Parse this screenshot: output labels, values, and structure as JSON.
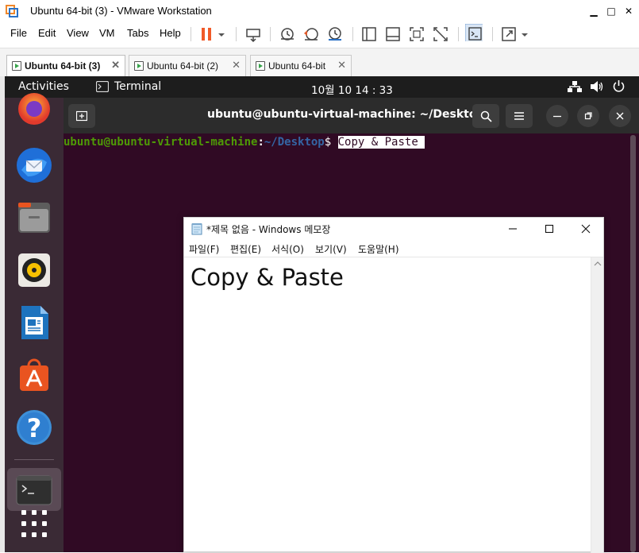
{
  "vmware": {
    "title": "Ubuntu 64-bit (3) - VMware Workstation",
    "menus": [
      "File",
      "Edit",
      "View",
      "VM",
      "Tabs",
      "Help"
    ],
    "tabs": [
      {
        "label": "Ubuntu 64-bit (3)",
        "active": true
      },
      {
        "label": "Ubuntu 64-bit (2)",
        "active": false
      },
      {
        "label": "Ubuntu 64-bit",
        "active": false
      }
    ],
    "colors": {
      "pause": "#f05a28",
      "snapshot": "#e05a2a"
    }
  },
  "ubuntu": {
    "topbar": {
      "activities": "Activities",
      "app": "Terminal",
      "clock": "10월 10  14 : 33"
    },
    "dock": [
      "firefox-icon",
      "thunderbird-icon",
      "files-icon",
      "rhythmbox-icon",
      "writer-icon",
      "software-icon",
      "help-icon",
      "terminal-icon",
      "app-grid-icon"
    ]
  },
  "terminal": {
    "title": "ubuntu@ubuntu-virtual-machine: ~/Desktop",
    "prompt_user": "ubuntu@ubuntu-virtual-machine",
    "prompt_sep": ":",
    "prompt_path": "~/Desktop",
    "prompt_symbol": "$",
    "command": "Copy & Paste ",
    "colors": {
      "user": "#4e9a06",
      "path": "#3465a4",
      "bg": "#300a24"
    }
  },
  "notepad": {
    "title": "*제목 없음 - Windows 메모장",
    "menus": [
      "파일(F)",
      "편집(E)",
      "서식(O)",
      "보기(V)",
      "도움말(H)"
    ],
    "content": "Copy & Paste"
  }
}
